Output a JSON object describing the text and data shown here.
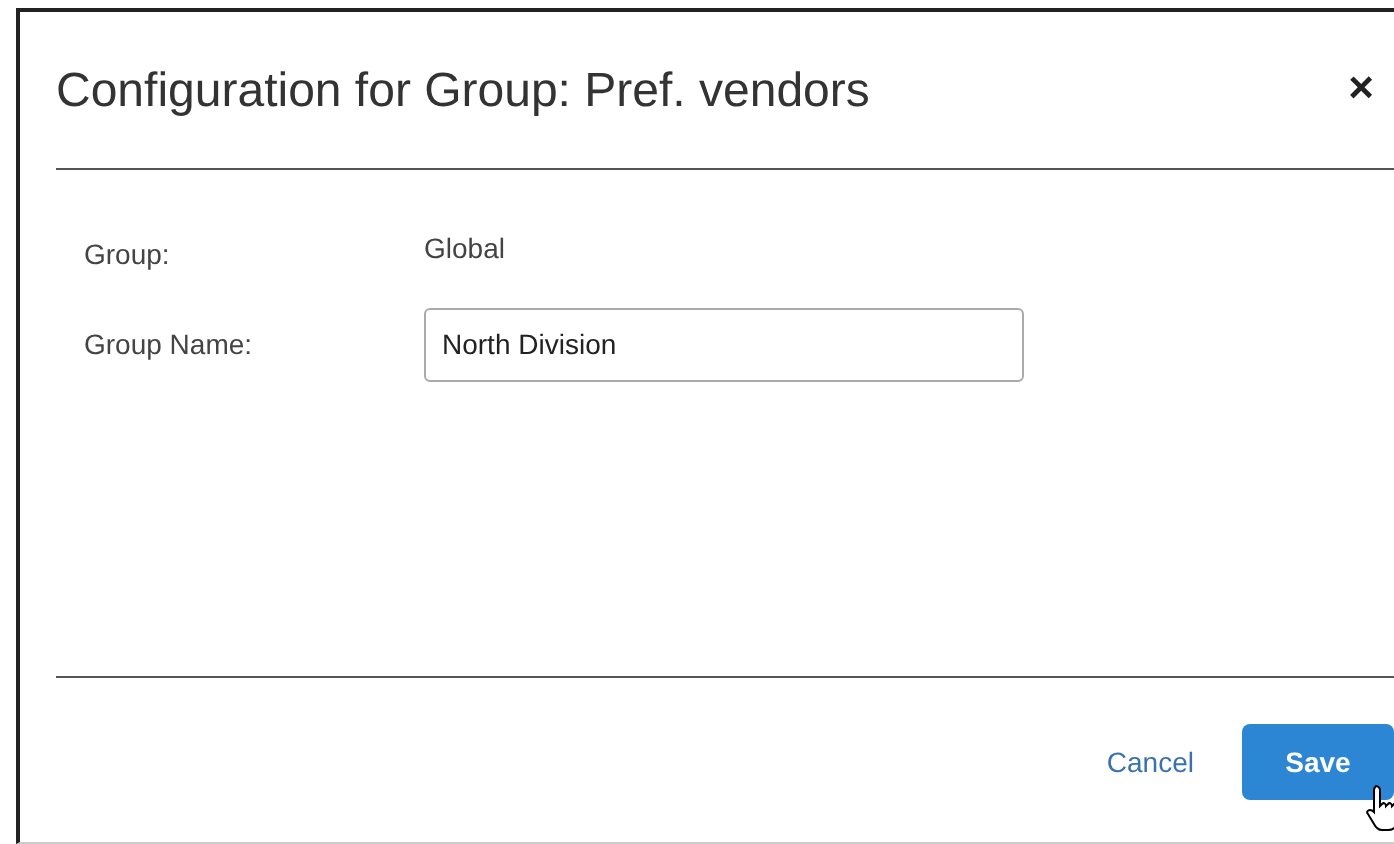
{
  "dialog": {
    "title": "Configuration for Group: Pref. vendors",
    "close": "×"
  },
  "fields": [
    {
      "kind": "text",
      "label": "Group:",
      "value": "Global"
    },
    {
      "kind": "input",
      "label": "Group Name:",
      "value": "North Division"
    }
  ],
  "buttons": [
    {
      "kind": "link",
      "label": "Cancel"
    },
    {
      "kind": "primary",
      "label": "Save"
    }
  ]
}
